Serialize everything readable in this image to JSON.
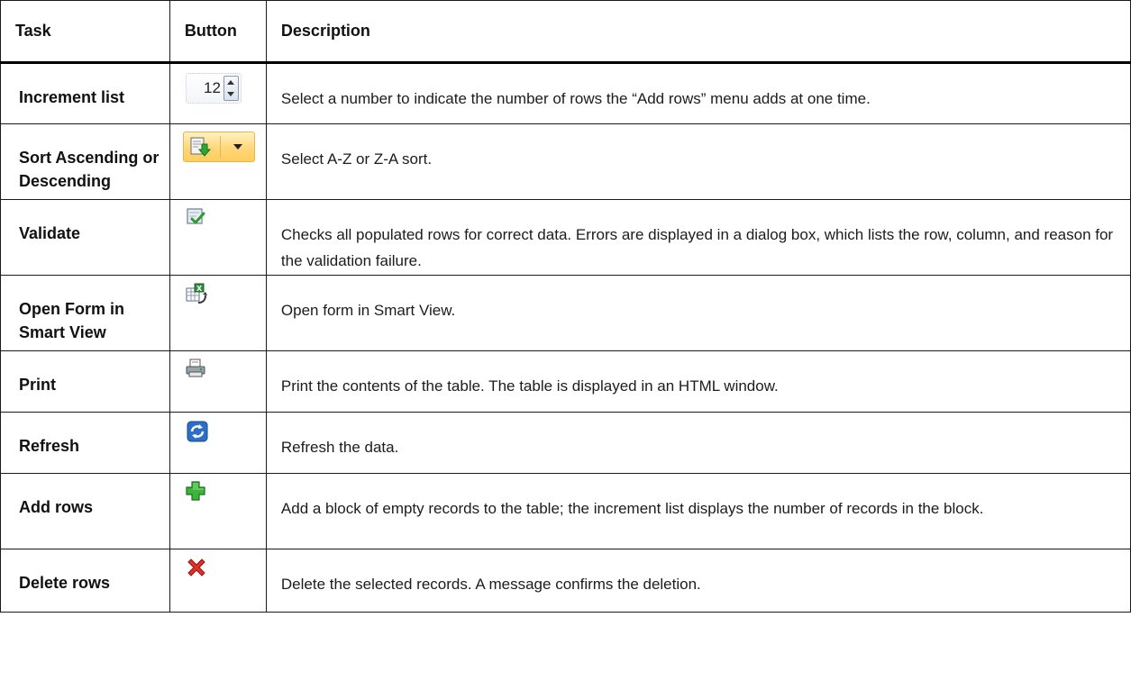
{
  "headers": {
    "task": "Task",
    "button": "Button",
    "description": "Description"
  },
  "rows": [
    {
      "task": "Increment list",
      "icon": "increment-spinner-icon",
      "spinner_value": "12",
      "description": "Select a number to indicate the number of rows the “Add rows” menu adds at one time."
    },
    {
      "task": "Sort Ascending or Descending",
      "icon": "sort-icon",
      "description": "Select A-Z or Z-A sort."
    },
    {
      "task": "Validate",
      "icon": "validate-checkmark-icon",
      "description": "Checks all populated rows for correct data. Errors are displayed in a dialog box, which lists the row, column, and reason for the validation failure."
    },
    {
      "task": "Open Form in Smart View",
      "icon": "smart-view-icon",
      "description": "Open form in Smart View."
    },
    {
      "task": "Print",
      "icon": "printer-icon",
      "description": "Print the contents of the table. The table is displayed in an HTML window."
    },
    {
      "task": "Refresh",
      "icon": "refresh-icon",
      "description": "Refresh the data."
    },
    {
      "task": "Add rows",
      "icon": "plus-icon",
      "description": "Add a block of empty records to the table; the increment list displays the number of records in the block."
    },
    {
      "task": "Delete rows",
      "icon": "delete-x-icon",
      "description": "Delete the selected records. A message confirms the deletion."
    }
  ]
}
